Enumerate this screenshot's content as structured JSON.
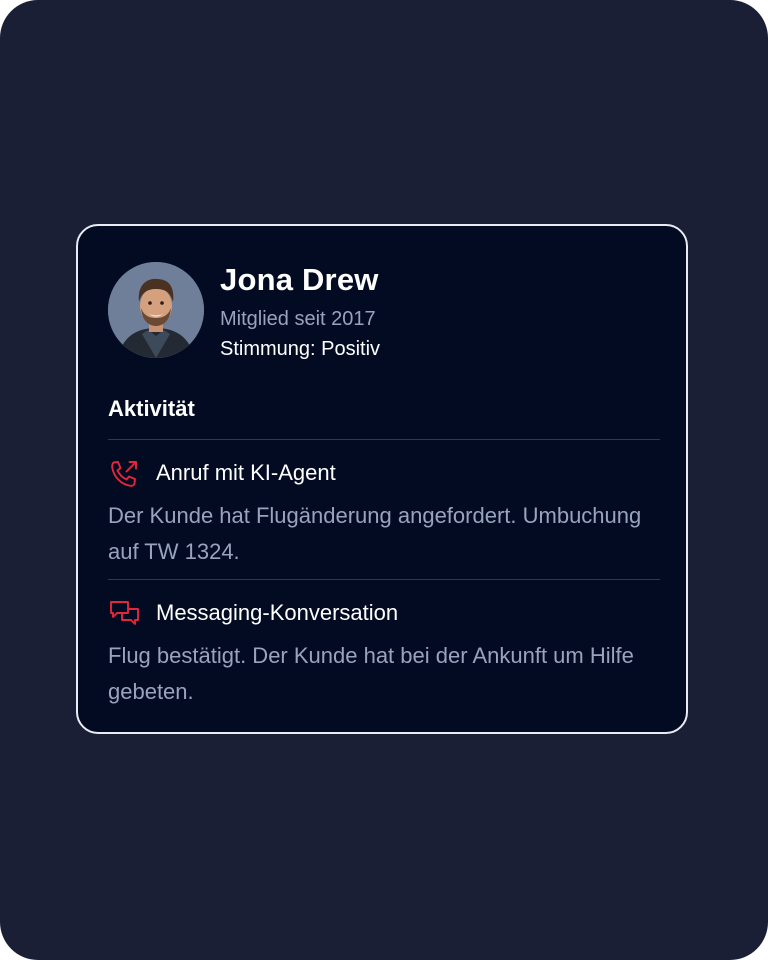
{
  "profile": {
    "name": "Jona Drew",
    "member_since": "Mitglied seit 2017",
    "mood": "Stimmung: Positiv"
  },
  "activity_section": {
    "title": "Aktivität",
    "items": [
      {
        "icon": "phone-call-icon",
        "title": "Anruf mit KI-Agent",
        "description": "Der Kunde hat Flugänderung angefordert. Umbuchung auf TW 1324."
      },
      {
        "icon": "chat-bubbles-icon",
        "title": "Messaging-Konversation",
        "description": "Flug bestätigt. Der Kunde hat bei der Ankunft um Hilfe gebeten."
      }
    ]
  },
  "colors": {
    "page_background": "#1b1f36",
    "card_background": "#020b21",
    "icon_accent": "#e0273d",
    "muted_text": "#9aa3bd"
  }
}
